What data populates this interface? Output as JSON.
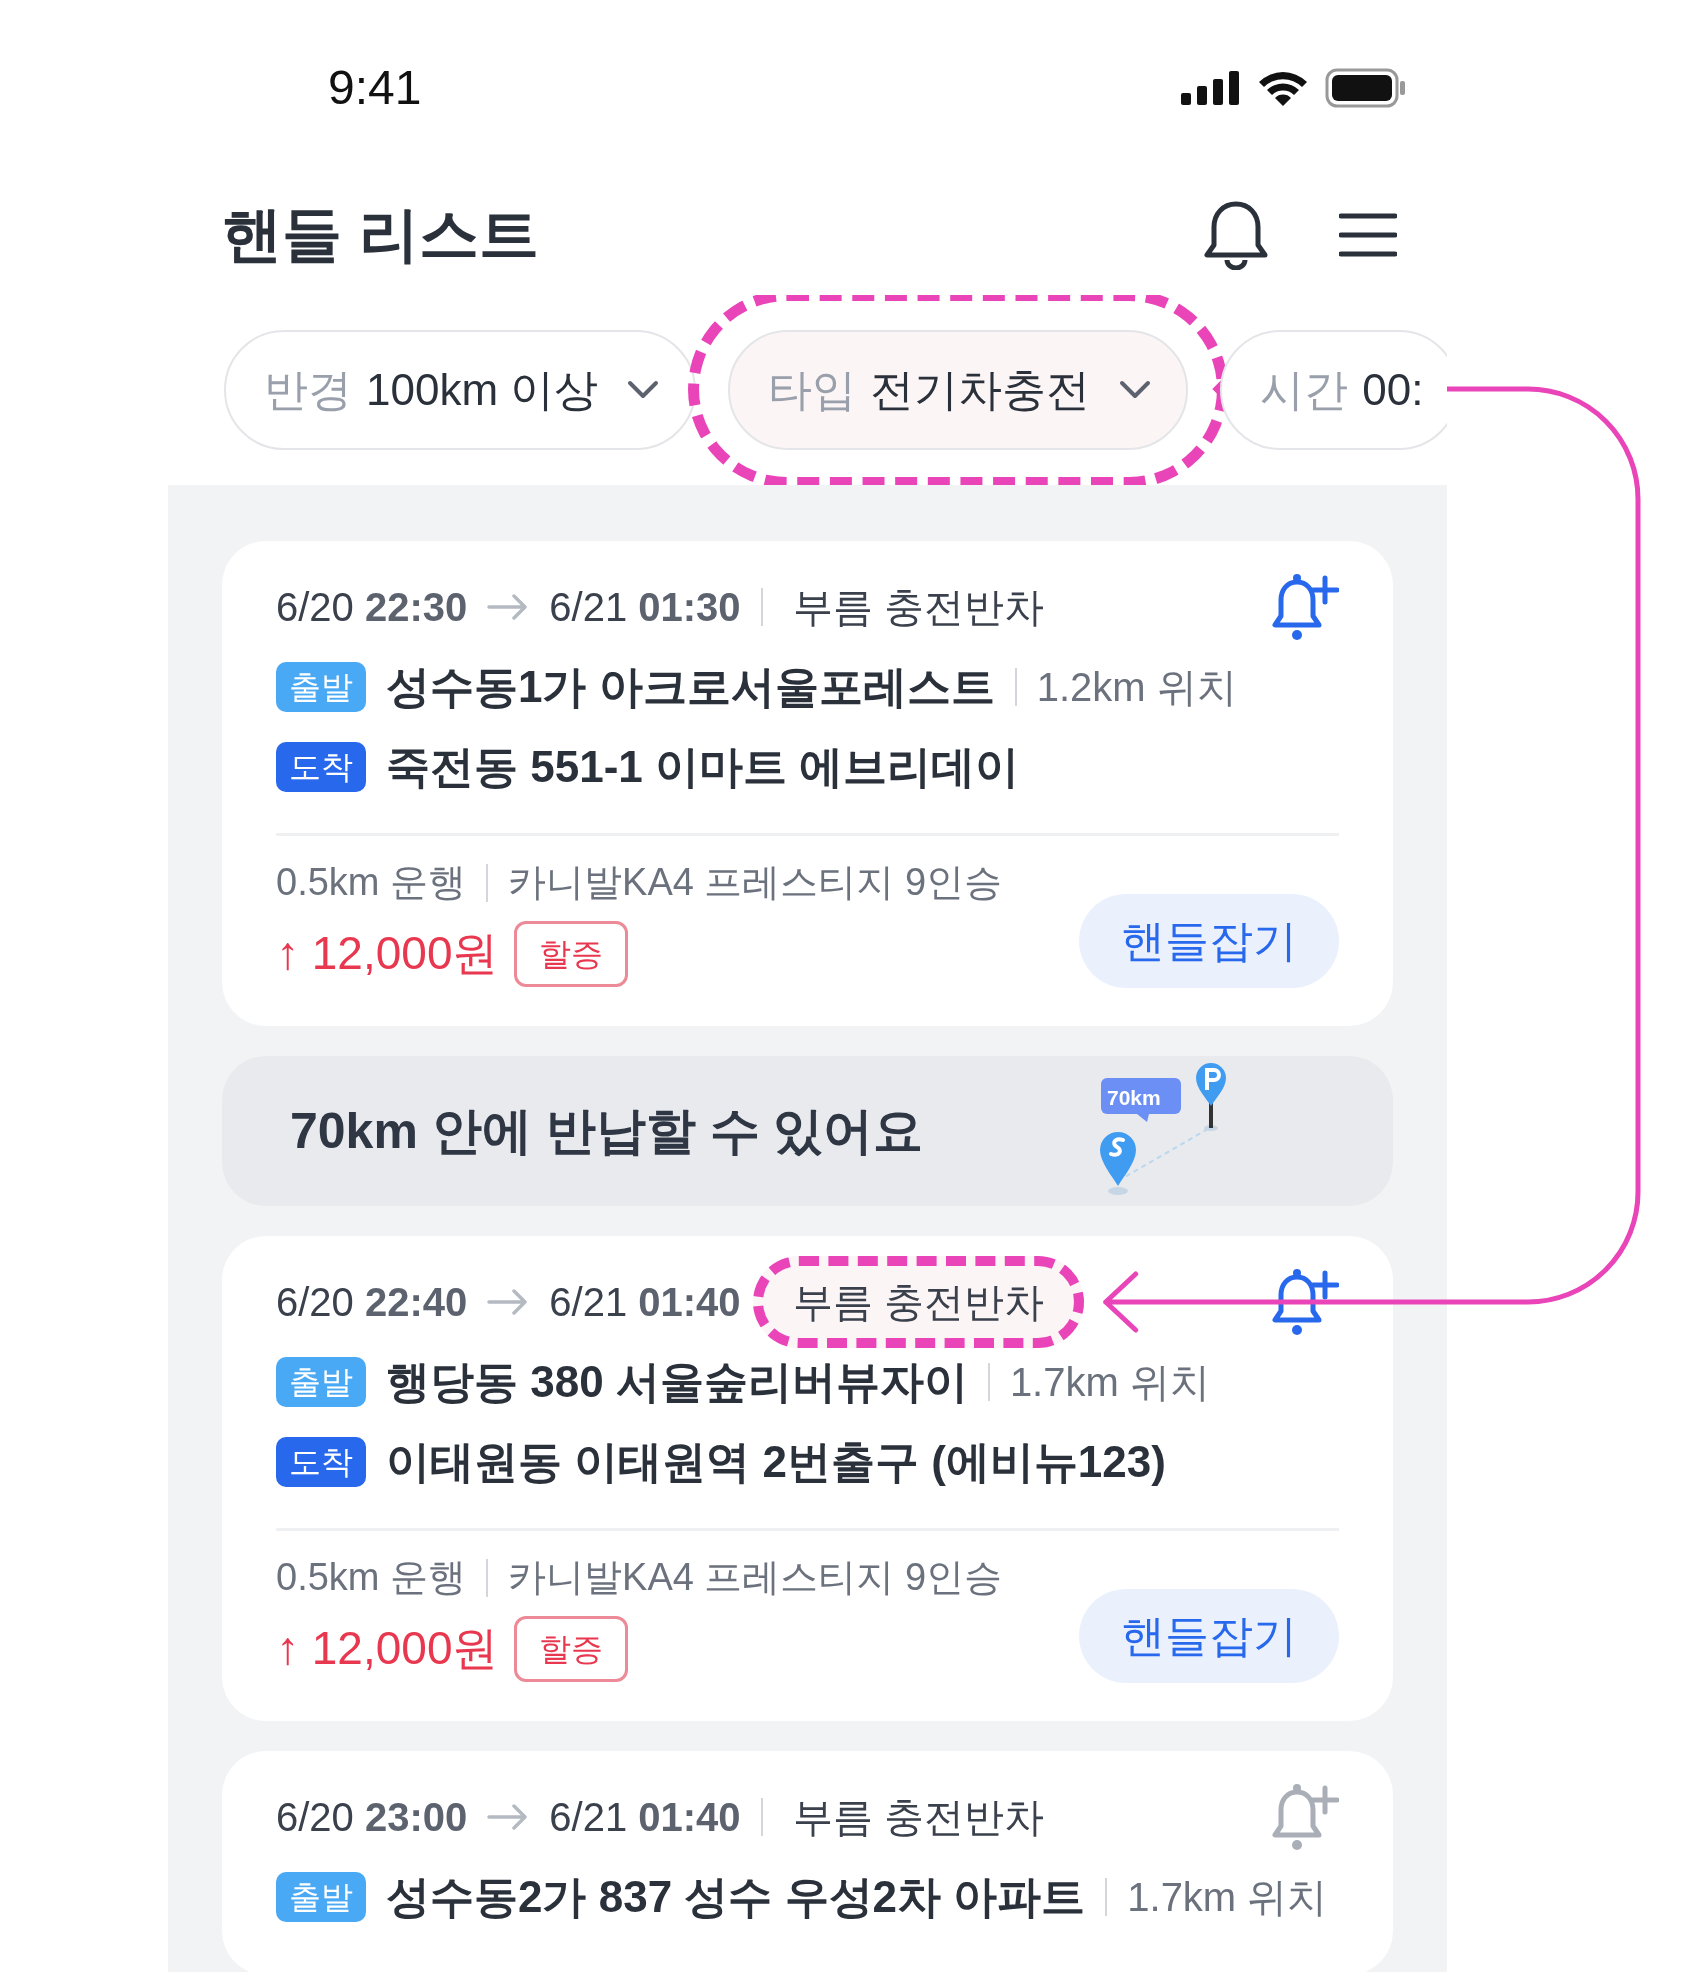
{
  "status_bar": {
    "time": "9:41"
  },
  "header": {
    "title": "핸들 리스트"
  },
  "filters": [
    {
      "label": "반경",
      "value": "100km 이상",
      "highlighted": false
    },
    {
      "label": "타입",
      "value": "전기차충전",
      "highlighted": true
    },
    {
      "label": "시간",
      "value": "00:",
      "highlighted": false
    }
  ],
  "cards": [
    {
      "kind": "trip",
      "depart_date": "6/20",
      "depart_time": "22:30",
      "arrive_date": "6/21",
      "arrive_time": "01:30",
      "type": "부름 충전반차",
      "type_highlighted": false,
      "alert_enabled": true,
      "start_tag": "출발",
      "start": "성수동1가 아크로서울포레스트",
      "start_distance": "1.2km 위치",
      "end_tag": "도착",
      "end": "죽전동 551-1 이마트 에브리데이",
      "drive": "0.5km 운행",
      "car": "카니발KA4 프레스티지 9인승",
      "price_arrow": "↑",
      "price": "12,000원",
      "surcharge": "할증",
      "action": "핸들잡기"
    },
    {
      "kind": "banner",
      "text": "70km 안에 반납할 수 있어요",
      "badge": "70km"
    },
    {
      "kind": "trip",
      "depart_date": "6/20",
      "depart_time": "22:40",
      "arrive_date": "6/21",
      "arrive_time": "01:40",
      "type": "부름 충전반차",
      "type_highlighted": true,
      "alert_enabled": true,
      "start_tag": "출발",
      "start": "행당동 380 서울숲리버뷰자이",
      "start_distance": "1.7km 위치",
      "end_tag": "도착",
      "end": "이태원동 이태원역 2번출구 (에비뉴123)",
      "drive": "0.5km 운행",
      "car": "카니발KA4 프레스티지 9인승",
      "price_arrow": "↑",
      "price": "12,000원",
      "surcharge": "할증",
      "action": "핸들잡기"
    },
    {
      "kind": "trip",
      "depart_date": "6/20",
      "depart_time": "23:00",
      "arrive_date": "6/21",
      "arrive_time": "01:40",
      "type": "부름 충전반차",
      "type_highlighted": false,
      "alert_enabled": false,
      "start_tag": "출발",
      "start": "성수동2가 837 성수 우성2차 아파트",
      "start_distance": "1.7km 위치"
    }
  ]
}
